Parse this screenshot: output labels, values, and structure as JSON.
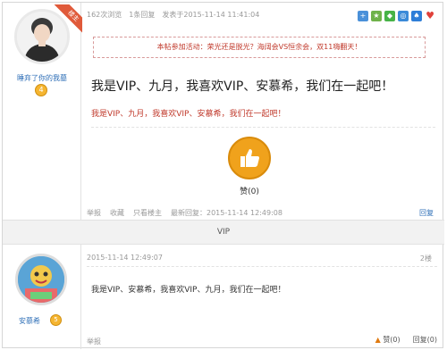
{
  "post1": {
    "ribbon": "楼主",
    "username": "睡弃了你的我墓",
    "level": "4",
    "meta": [
      "162次浏览",
      "1条回复",
      "发表于2015-11-14 11:41:04"
    ],
    "share_icons": [
      "plus-icon",
      "star-icon",
      "wechat-icon",
      "weibo-icon",
      "qq-icon",
      "heart-icon"
    ],
    "notice": "本帖参加活动：荣光还是脱光？海阔会VS恒余会，双11嗨翻天！",
    "big_text": "我是VIP、九月，我喜欢VIP、安慕希，我们在一起吧！",
    "small_text": "我是VIP、九月，我喜欢VIP、安慕希，我们在一起吧！",
    "like_label": "赞(0)",
    "footer": [
      "举报",
      "收藏",
      "只看楼主",
      "最新回复：2015-11-14 12:49:08"
    ],
    "reply_label": "回复"
  },
  "vip_bar": "VIP",
  "post2": {
    "username": "安慕希",
    "level": "5",
    "date": "2015-11-14 12:49:07",
    "floor": "2楼",
    "text": "我是VIP、安慕希，我喜欢VIP、九月，我们在一起吧！",
    "report": "举报",
    "like_label": "赞(0)",
    "reply_label": "回复(0)"
  },
  "colors": {
    "accent": "#2f6fb7",
    "notice_red": "#c0392b",
    "like_orange": "#f0a21c"
  }
}
